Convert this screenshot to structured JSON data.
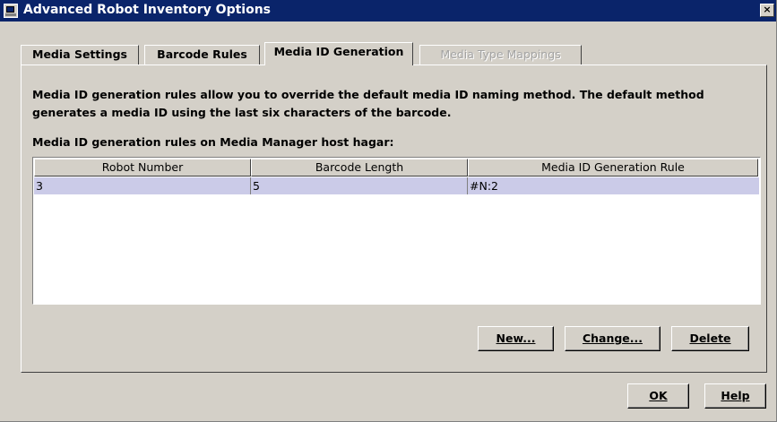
{
  "window": {
    "title": "Advanced Robot Inventory Options",
    "close_glyph": "×"
  },
  "tabs": [
    {
      "label": "Media Settings",
      "state": "normal"
    },
    {
      "label": "Barcode Rules",
      "state": "normal"
    },
    {
      "label": "Media ID Generation",
      "state": "active"
    },
    {
      "label": "Media Type Mappings",
      "state": "disabled"
    }
  ],
  "panel": {
    "description_line1": "Media ID generation rules allow you to override the default media ID naming method.  The default method",
    "description_line2": "generates a media ID using the last six characters of the barcode.",
    "table_caption": "Media ID generation rules on Media Manager host hagar:"
  },
  "table": {
    "columns": [
      "Robot Number",
      "Barcode Length",
      "Media ID Generation Rule"
    ],
    "rows": [
      [
        "3",
        "5",
        "#N:2"
      ]
    ]
  },
  "panel_buttons": {
    "new": "New...",
    "change": "Change...",
    "delete": "Delete"
  },
  "dialog_buttons": {
    "ok": "OK",
    "help": "Help"
  },
  "colors": {
    "title_bar": "#0a246a",
    "selected_row": "#cbcbe8",
    "face": "#d4d0c8"
  }
}
